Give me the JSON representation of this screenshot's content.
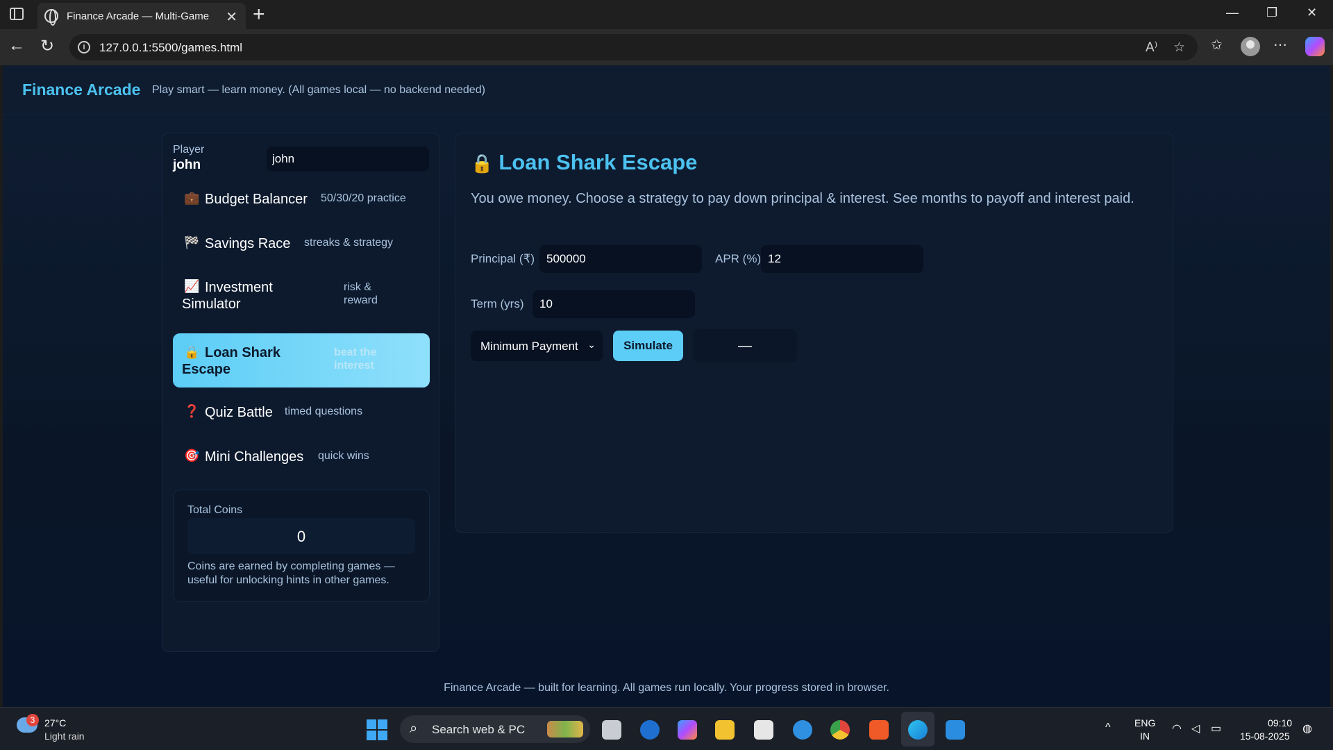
{
  "browser": {
    "tab_title": "Finance Arcade — Multi-Game",
    "url": "127.0.0.1:5500/games.html"
  },
  "header": {
    "brand": "Finance Arcade",
    "tagline": "Play smart — learn money. (All games local — no backend needed)"
  },
  "sidebar": {
    "player_label": "Player",
    "player_name": "john",
    "player_input_value": "john",
    "games": [
      {
        "icon": "💼",
        "name": "Budget Balancer",
        "desc": "50/30/20 practice"
      },
      {
        "icon": "🏁",
        "name": "Savings Race",
        "desc": "streaks & strategy"
      },
      {
        "icon": "📈",
        "name": "Investment Simulator",
        "desc": "risk & reward"
      },
      {
        "icon": "🔒",
        "name": "Loan Shark Escape",
        "desc": "beat the interest"
      },
      {
        "icon": "❓",
        "name": "Quiz Battle",
        "desc": "timed questions"
      },
      {
        "icon": "🎯",
        "name": "Mini Challenges",
        "desc": "quick wins"
      }
    ],
    "coins_label": "Total Coins",
    "coins_value": "0",
    "coins_note": "Coins are earned by completing games — useful for unlocking hints in other games."
  },
  "main": {
    "title_icon": "🔒",
    "title": "Loan Shark Escape",
    "description": "You owe money. Choose a strategy to pay down principal & interest. See months to payoff and interest paid.",
    "principal_label": "Principal (₹)",
    "principal_value": "500000",
    "apr_label": "APR (%)",
    "apr_value": "12",
    "term_label": "Term (yrs)",
    "term_value": "10",
    "strategy_selected": "Minimum Payment",
    "simulate_label": "Simulate",
    "result": "—"
  },
  "footer": "Finance Arcade — built for learning. All games run locally. Your progress stored in browser.",
  "taskbar": {
    "weather_badge": "3",
    "weather_temp": "27°C",
    "weather_desc": "Light rain",
    "search_placeholder": "Search web & PC",
    "lang_top": "ENG",
    "lang_bottom": "IN",
    "time": "09:10",
    "date": "15-08-2025"
  }
}
